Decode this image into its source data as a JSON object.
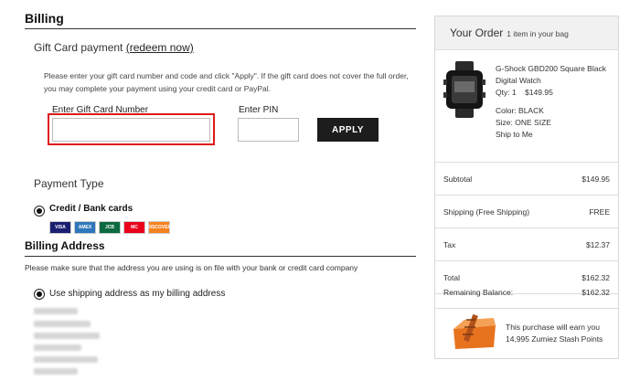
{
  "billing": {
    "heading": "Billing",
    "gift_card": {
      "title": "Gift Card payment",
      "redeem_link": "(redeem now)",
      "description": "Please enter your gift card number and code and click \"Apply\". If the gift card does not cover the full order, you may complete your payment using your credit card or PayPal.",
      "number_label": "Enter Gift Card Number",
      "number_value": "",
      "pin_label": "Enter PIN",
      "pin_value": "",
      "apply_label": "APPLY"
    },
    "payment_type": {
      "heading": "Payment Type",
      "option_label": "Credit / Bank cards",
      "cards": [
        {
          "name": "VISA",
          "color": "#1a1f71"
        },
        {
          "name": "AMEX",
          "color": "#2e77bb"
        },
        {
          "name": "JCB",
          "color": "#0b6a3f"
        },
        {
          "name": "MC",
          "color": "#eb001b"
        },
        {
          "name": "DISCOVER",
          "color": "#f58220"
        }
      ]
    }
  },
  "billing_address": {
    "heading": "Billing Address",
    "note": "Please make sure that the address you are using is on file with your bank or credit card company",
    "option_label": "Use shipping address as my billing address"
  },
  "order": {
    "title": "Your Order",
    "subtitle": "1 item in your bag",
    "product": {
      "name_line1": "G-Shock GBD200 Square Black",
      "name_line2": "Digital Watch",
      "qty_price": "Qty: 1    $149.95",
      "color": "Color: BLACK",
      "size": "Size: ONE SIZE",
      "shipping": "Ship to Me"
    },
    "rows": [
      {
        "label": "Subtotal",
        "value": "$149.95"
      },
      {
        "label": "Shipping (Free Shipping)",
        "value": "FREE"
      },
      {
        "label": "Tax",
        "value": "$12.37"
      },
      {
        "label": "Total",
        "value": "$162.32"
      },
      {
        "label": "Remaining Balance:",
        "value": "$162.32"
      }
    ],
    "stash_line1": "This purchase will earn you",
    "stash_line2": "14,995 Zumiez Stash Points"
  }
}
